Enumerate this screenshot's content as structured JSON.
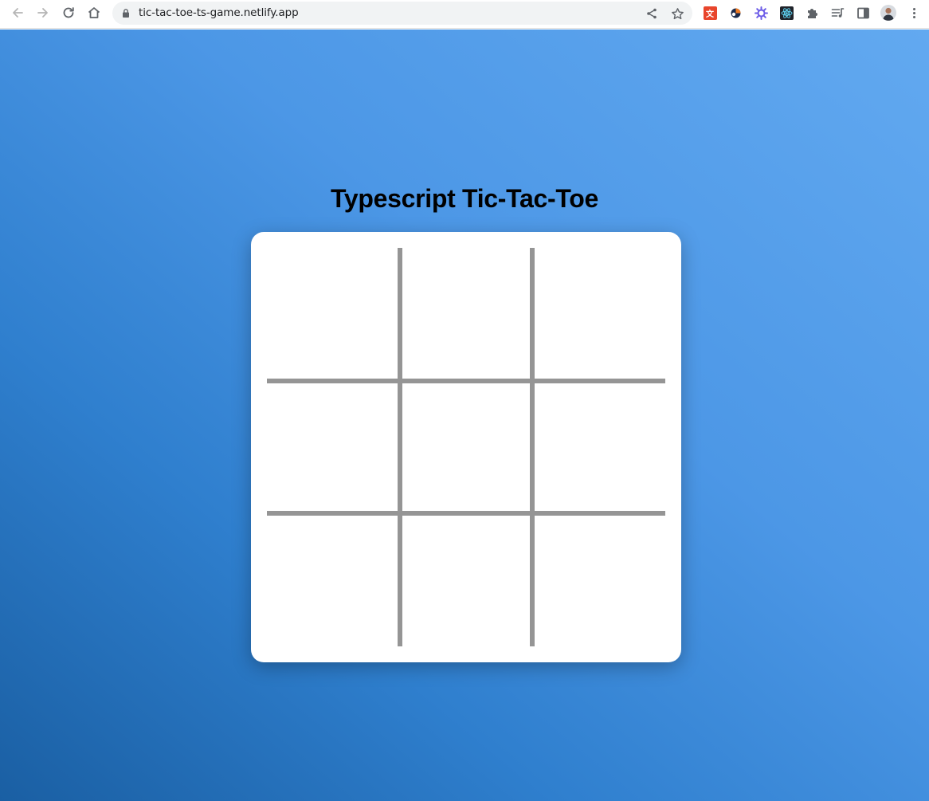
{
  "browser": {
    "url": "tic-tac-toe-ts-game.netlify.app",
    "nav_icons": [
      "back-arrow-icon",
      "forward-arrow-icon",
      "reload-icon",
      "home-icon"
    ],
    "extension_icons": [
      "translate-extension-icon",
      "extension-icon-orange",
      "extension-icon-purple-gear",
      "react-devtools-icon",
      "puzzle-icon",
      "reading-list-icon",
      "side-panel-icon",
      "profile-avatar",
      "kebab-menu-icon"
    ]
  },
  "game": {
    "title": "Typescript Tic-Tac-Toe",
    "cells": [
      "",
      "",
      "",
      "",
      "",
      "",
      "",
      "",
      ""
    ]
  },
  "colors": {
    "background_light": "#62a9f0",
    "background_dark": "#1a5fa3",
    "board_background": "#ffffff",
    "grid_line": "#959595",
    "title_text": "#000000"
  }
}
